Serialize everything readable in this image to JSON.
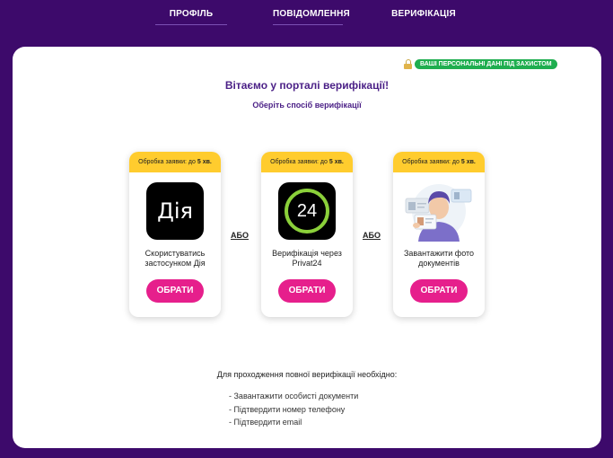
{
  "nav": {
    "tabs": [
      {
        "label": "ПРОФІЛЬ"
      },
      {
        "label": "ПОВІДОМЛЕННЯ"
      },
      {
        "label": "ВЕРИФІКАЦІЯ"
      }
    ]
  },
  "badge": {
    "text": "ВАШІ ПЕРСОНАЛЬНІ ДАНІ ПІД ЗАХИСТОМ",
    "icon": "lock-icon",
    "color": "#1fae4f"
  },
  "welcome": {
    "title": "Вітаємо у порталі верифікації!",
    "subtitle": "Оберіть спосіб верифікації"
  },
  "cards": [
    {
      "header_prefix": "Обробка заявки: до ",
      "header_time": "5 хв.",
      "logo_text": "Дія",
      "caption": "Скористуватись застосунком Дія",
      "button": "ОБРАТИ"
    },
    {
      "header_prefix": "Обробка заявки: до ",
      "header_time": "5 хв.",
      "logo_text": "24",
      "caption": "Верифікація через Privat24",
      "button": "ОБРАТИ"
    },
    {
      "header_prefix": "Обробка заявки: до ",
      "header_time": "5 хв.",
      "logo_text": "",
      "caption": "Завантажити фото документів",
      "button": "ОБРАТИ"
    }
  ],
  "or_label": "АБО",
  "requirements": {
    "title": "Для проходження повної верифікації необхідно:",
    "items": [
      "- Завантажити особисті документи",
      "- Підтвердити номер телефону",
      "- Підтвердити email"
    ]
  },
  "colors": {
    "background": "#3d0a6b",
    "accent": "#e61f8c",
    "header_yellow": "#ffcc2e",
    "title_purple": "#4a1f86"
  }
}
